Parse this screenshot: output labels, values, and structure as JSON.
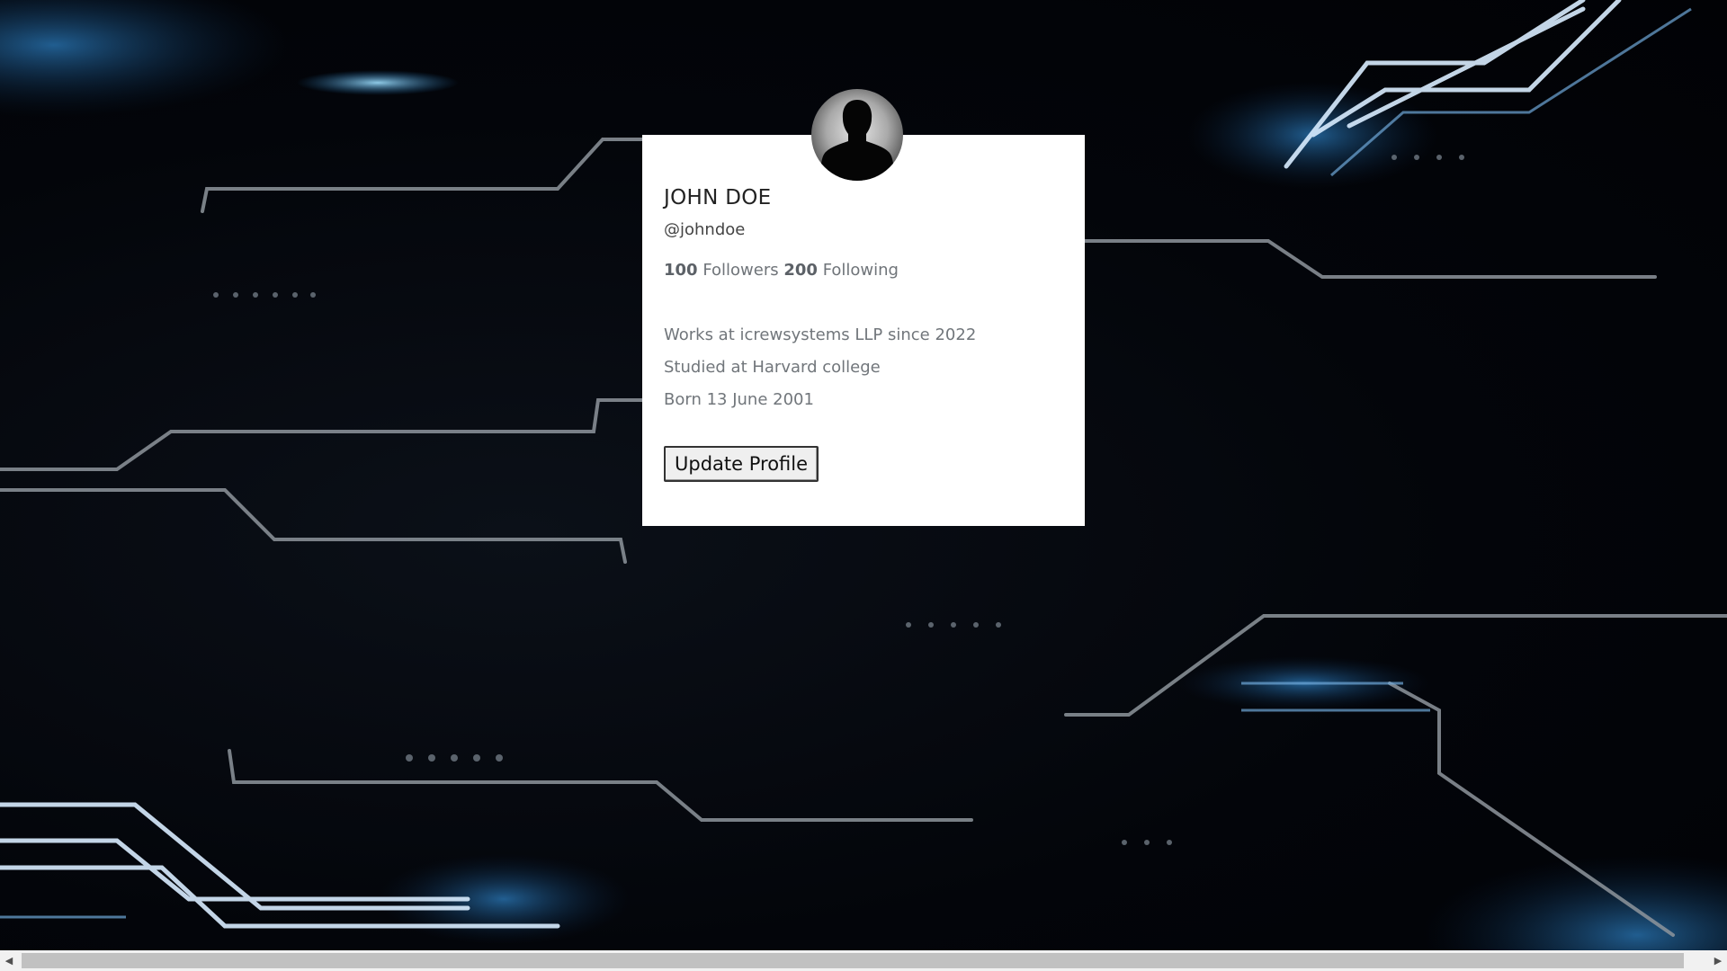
{
  "profile": {
    "name": "JOHN DOE",
    "handle": "@johndoe",
    "followers_count": "100",
    "followers_label": "Followers",
    "following_count": "200",
    "following_label": "Following",
    "details": [
      "Works at icrewsystems LLP since 2022",
      "Studied at Harvard college",
      "Born 13 June 2001"
    ],
    "update_button_label": "Update Profile"
  },
  "icons": {
    "avatar": "user-silhouette-icon",
    "scroll_left": "chevron-left-icon",
    "scroll_right": "chevron-right-icon"
  },
  "colors": {
    "background": "#02040a",
    "card": "#ffffff",
    "accent_glow": "#4fb8ff"
  }
}
